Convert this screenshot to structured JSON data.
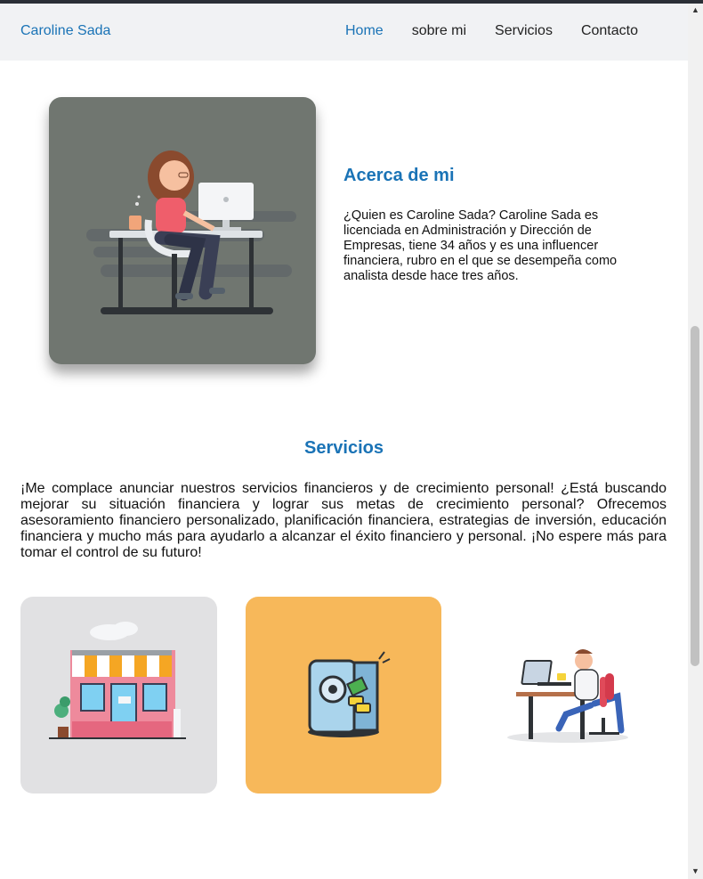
{
  "brand": "Caroline Sada",
  "nav": {
    "items": [
      {
        "label": "Home",
        "active": true
      },
      {
        "label": "sobre mi",
        "active": false
      },
      {
        "label": "Servicios",
        "active": false
      },
      {
        "label": "Contacto",
        "active": false
      }
    ]
  },
  "about": {
    "title": "Acerca de mi",
    "text": "¿Quien es Caroline Sada? Caroline Sada es licenciada en Administración y Dirección de Empresas, tiene 34 años y es una influencer financiera, rubro en el que se desempeña como analista desde hace tres años."
  },
  "services": {
    "title": "Servicios",
    "text": "¡Me complace anunciar nuestros servicios financieros y de crecimiento personal! ¿Está buscando mejorar su situación financiera y lograr sus metas de crecimiento personal? Ofrecemos asesoramiento financiero personalizado, planificación financiera, estrategias de inversión, educación financiera y mucho más para ayudarlo a alcanzar el éxito financiero y personal. ¡No espere más para tomar el control de su futuro!"
  },
  "colors": {
    "accent": "#1a73b6",
    "navbar_bg": "#f1f2f4",
    "about_card_bg": "#707670",
    "card_orange": "#f7b85a",
    "card_gray": "#e1e1e3"
  },
  "icons": [
    "scroll-up-arrow-icon",
    "scroll-down-arrow-icon"
  ]
}
